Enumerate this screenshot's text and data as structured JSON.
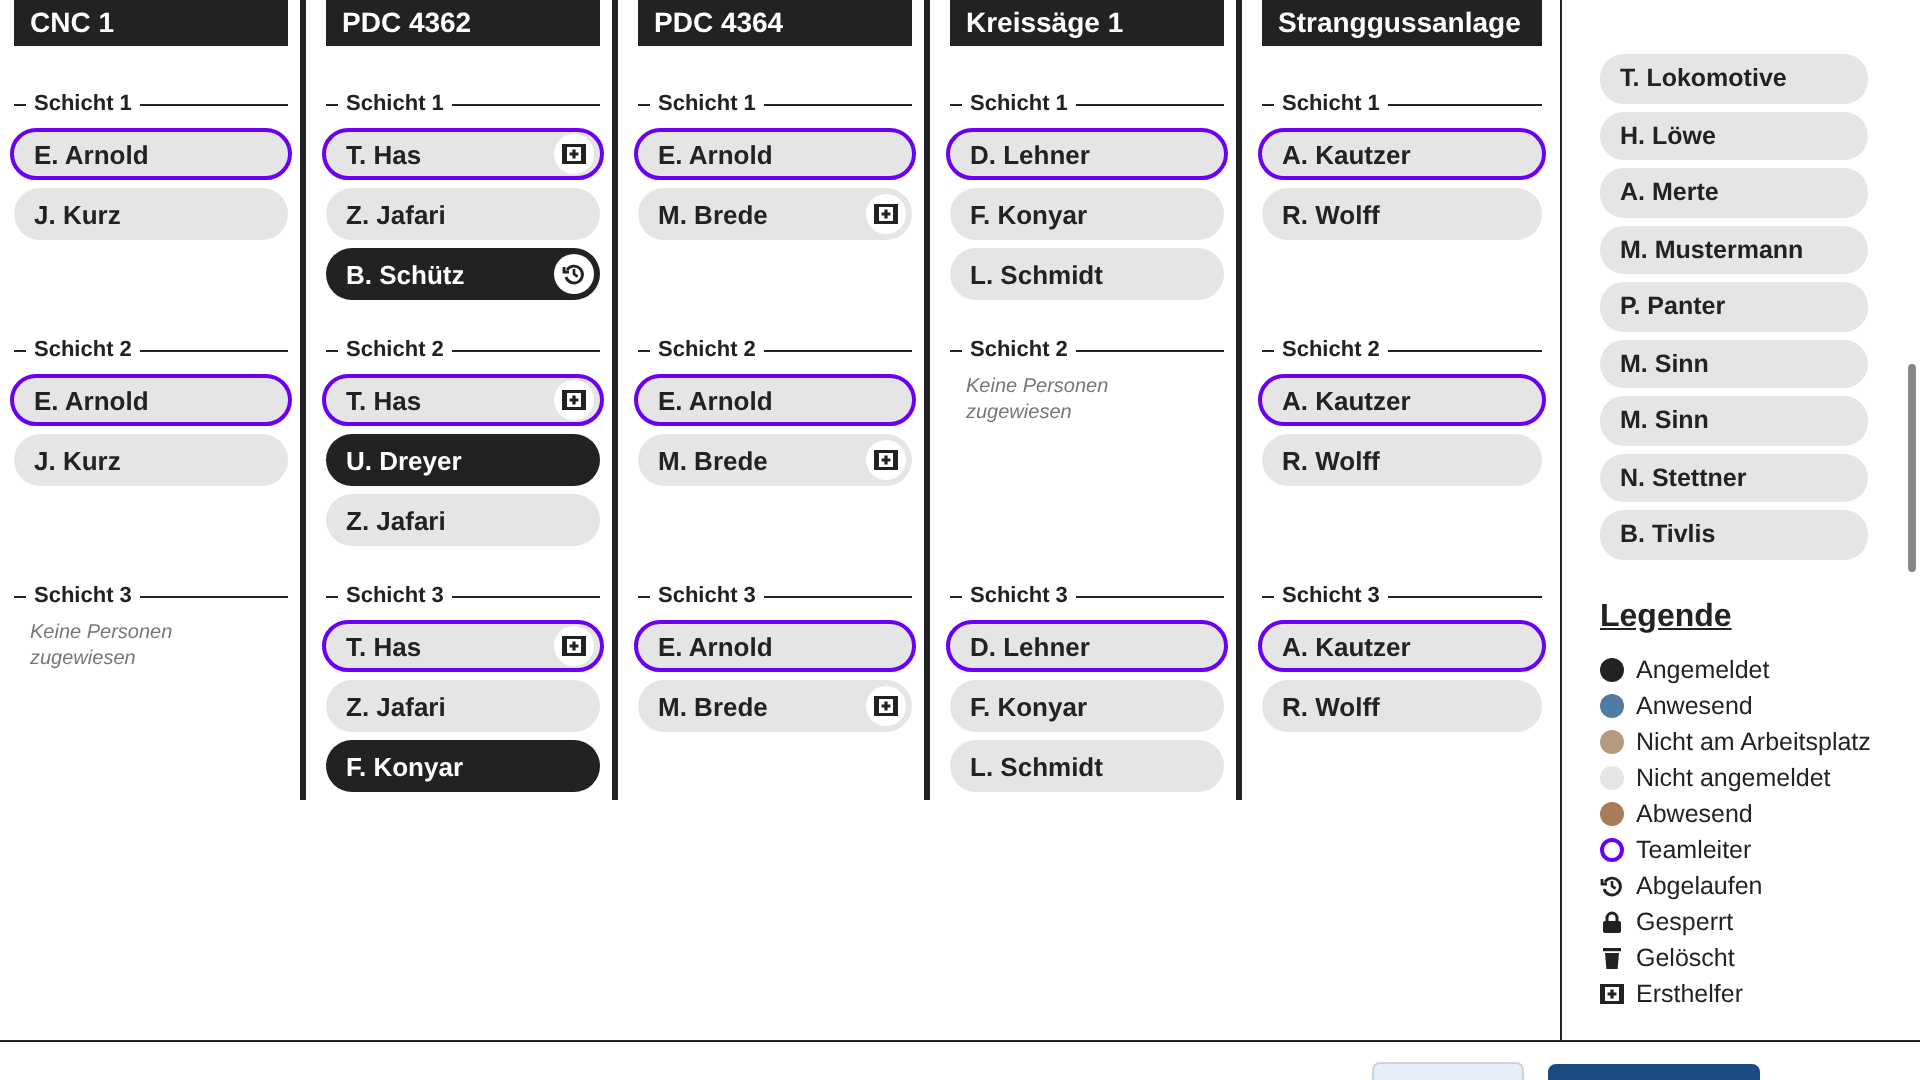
{
  "stations": [
    {
      "name": "CNC 1",
      "shifts": [
        {
          "label": "Schicht 1",
          "people": [
            {
              "name": "E. Arnold",
              "logged_in": false,
              "leader": true,
              "first_aider": false,
              "expired": false
            },
            {
              "name": "J. Kurz",
              "logged_in": false,
              "leader": false,
              "first_aider": false,
              "expired": false
            }
          ]
        },
        {
          "label": "Schicht 2",
          "people": [
            {
              "name": "E. Arnold",
              "logged_in": false,
              "leader": true,
              "first_aider": false,
              "expired": false
            },
            {
              "name": "J. Kurz",
              "logged_in": false,
              "leader": false,
              "first_aider": false,
              "expired": false
            }
          ]
        },
        {
          "label": "Schicht 3",
          "empty_text": "Keine Personen zugewiesen"
        }
      ]
    },
    {
      "name": "PDC 4362",
      "shifts": [
        {
          "label": "Schicht 1",
          "people": [
            {
              "name": "T. Has",
              "logged_in": false,
              "leader": true,
              "first_aider": true,
              "expired": false
            },
            {
              "name": "Z. Jafari",
              "logged_in": false,
              "leader": false,
              "first_aider": false,
              "expired": false
            },
            {
              "name": "B. Schütz",
              "logged_in": true,
              "leader": false,
              "first_aider": false,
              "expired": true
            }
          ]
        },
        {
          "label": "Schicht 2",
          "people": [
            {
              "name": "T. Has",
              "logged_in": false,
              "leader": true,
              "first_aider": true,
              "expired": false
            },
            {
              "name": "U. Dreyer",
              "logged_in": true,
              "leader": false,
              "first_aider": false,
              "expired": false
            },
            {
              "name": "Z. Jafari",
              "logged_in": false,
              "leader": false,
              "first_aider": false,
              "expired": false
            }
          ]
        },
        {
          "label": "Schicht 3",
          "people": [
            {
              "name": "T. Has",
              "logged_in": false,
              "leader": true,
              "first_aider": true,
              "expired": false
            },
            {
              "name": "Z. Jafari",
              "logged_in": false,
              "leader": false,
              "first_aider": false,
              "expired": false
            },
            {
              "name": "F. Konyar",
              "logged_in": true,
              "leader": false,
              "first_aider": false,
              "expired": false
            }
          ]
        }
      ]
    },
    {
      "name": "PDC 4364",
      "shifts": [
        {
          "label": "Schicht 1",
          "people": [
            {
              "name": "E. Arnold",
              "logged_in": false,
              "leader": true,
              "first_aider": false,
              "expired": false
            },
            {
              "name": "M. Brede",
              "logged_in": false,
              "leader": false,
              "first_aider": true,
              "expired": false
            }
          ]
        },
        {
          "label": "Schicht 2",
          "people": [
            {
              "name": "E. Arnold",
              "logged_in": false,
              "leader": true,
              "first_aider": false,
              "expired": false
            },
            {
              "name": "M. Brede",
              "logged_in": false,
              "leader": false,
              "first_aider": true,
              "expired": false
            }
          ]
        },
        {
          "label": "Schicht 3",
          "people": [
            {
              "name": "E. Arnold",
              "logged_in": false,
              "leader": true,
              "first_aider": false,
              "expired": false
            },
            {
              "name": "M. Brede",
              "logged_in": false,
              "leader": false,
              "first_aider": true,
              "expired": false
            }
          ]
        }
      ]
    },
    {
      "name": "Kreissäge 1",
      "shifts": [
        {
          "label": "Schicht 1",
          "people": [
            {
              "name": "D. Lehner",
              "logged_in": false,
              "leader": true,
              "first_aider": false,
              "expired": false
            },
            {
              "name": "F. Konyar",
              "logged_in": false,
              "leader": false,
              "first_aider": false,
              "expired": false
            },
            {
              "name": "L. Schmidt",
              "logged_in": false,
              "leader": false,
              "first_aider": false,
              "expired": false
            }
          ]
        },
        {
          "label": "Schicht 2",
          "empty_text": "Keine Personen zugewiesen"
        },
        {
          "label": "Schicht 3",
          "people": [
            {
              "name": "D. Lehner",
              "logged_in": false,
              "leader": true,
              "first_aider": false,
              "expired": false
            },
            {
              "name": "F. Konyar",
              "logged_in": false,
              "leader": false,
              "first_aider": false,
              "expired": false
            },
            {
              "name": "L. Schmidt",
              "logged_in": false,
              "leader": false,
              "first_aider": false,
              "expired": false
            }
          ]
        }
      ]
    },
    {
      "name": "Stranggussanlage",
      "shifts": [
        {
          "label": "Schicht 1",
          "people": [
            {
              "name": "A. Kautzer",
              "logged_in": false,
              "leader": true,
              "first_aider": false,
              "expired": false
            },
            {
              "name": "R. Wolff",
              "logged_in": false,
              "leader": false,
              "first_aider": false,
              "expired": false
            }
          ]
        },
        {
          "label": "Schicht 2",
          "people": [
            {
              "name": "A. Kautzer",
              "logged_in": false,
              "leader": true,
              "first_aider": false,
              "expired": false
            },
            {
              "name": "R. Wolff",
              "logged_in": false,
              "leader": false,
              "first_aider": false,
              "expired": false
            }
          ]
        },
        {
          "label": "Schicht 3",
          "people": [
            {
              "name": "A. Kautzer",
              "logged_in": false,
              "leader": true,
              "first_aider": false,
              "expired": false
            },
            {
              "name": "R. Wolff",
              "logged_in": false,
              "leader": false,
              "first_aider": false,
              "expired": false
            }
          ]
        }
      ]
    }
  ],
  "sidebar": {
    "people": [
      "T. Lokomotive",
      "H. Löwe",
      "A. Merte",
      "M. Mustermann",
      "P. Panter",
      "M. Sinn",
      "M. Sinn",
      "N. Stettner",
      "B. Tivlis"
    ],
    "legend_title": "Legende",
    "legend": [
      {
        "label": "Angemeldet",
        "kind": "dot",
        "color": "#222222"
      },
      {
        "label": "Anwesend",
        "kind": "dot",
        "color": "#4f7aa3"
      },
      {
        "label": "Nicht am Arbeitsplatz",
        "kind": "dot",
        "color": "#b59a7e"
      },
      {
        "label": "Nicht angemeldet",
        "kind": "dot",
        "color": "#e5e5e5"
      },
      {
        "label": "Abwesend",
        "kind": "dot",
        "color": "#a67c5b"
      },
      {
        "label": "Teamleiter",
        "kind": "ring",
        "color": "#6a00f4"
      },
      {
        "label": "Abgelaufen",
        "kind": "history"
      },
      {
        "label": "Gesperrt",
        "kind": "lock"
      },
      {
        "label": "Gelöscht",
        "kind": "trash"
      },
      {
        "label": "Ersthelfer",
        "kind": "firstaid"
      }
    ]
  }
}
